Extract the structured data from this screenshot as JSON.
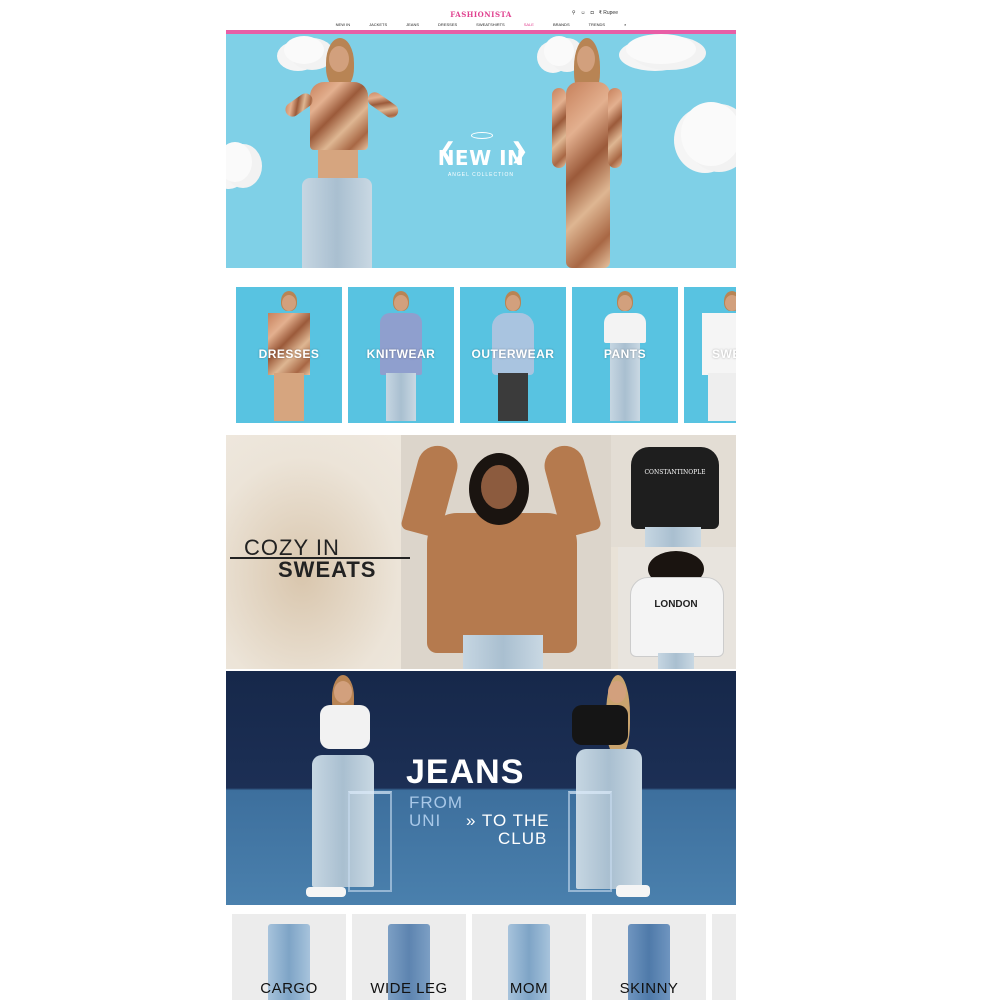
{
  "header": {
    "logo": "FASHIONISTA",
    "icons": [
      {
        "name": "location-pin-icon",
        "glyph": "⚲"
      },
      {
        "name": "user-icon",
        "glyph": "☺"
      },
      {
        "name": "bag-icon",
        "glyph": "◘"
      }
    ],
    "currency": "₹ Rupee",
    "nav": [
      "NEW IN",
      "JACKETS",
      "JEANS",
      "DRESSES",
      "SWEATSHIRTS",
      "SALE",
      "BRANDS",
      "TRENDS"
    ],
    "search_glyph": "⌕"
  },
  "hero": {
    "title": "NEW IN",
    "subtitle": "ANGEL COLLECTION"
  },
  "categories": [
    "DRESSES",
    "KNITWEAR",
    "OUTERWEAR",
    "PANTS",
    "SWE"
  ],
  "cozy": {
    "line1": "COZY IN",
    "line2": "SWEATS",
    "hoodie_text_1": "CONSTANTINOPLE",
    "hoodie_text_2": "LONDON"
  },
  "jeans": {
    "title": "JEANS",
    "from": "FROM",
    "uni": "UNI",
    "to_the": "» TO THE",
    "club": "CLUB"
  },
  "fits": [
    "CARGO",
    "WIDE LEG",
    "MOM",
    "SKINNY"
  ],
  "colors": {
    "accent": "#e0408f",
    "hero_bg": "#7fd0e7",
    "tile_bg": "#58c3e1",
    "navy": "#16284a"
  }
}
